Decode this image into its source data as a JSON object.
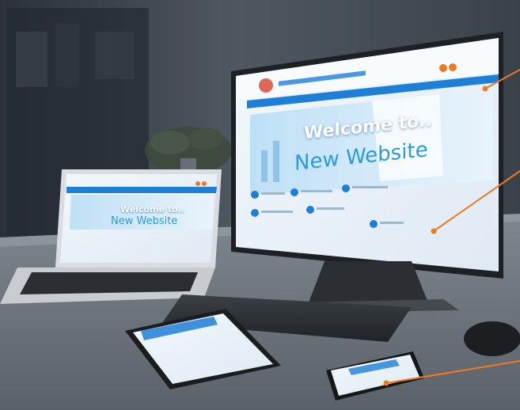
{
  "scene": {
    "description_kind": "responsive website mockup photo",
    "colors": {
      "wall": "#4a525a",
      "desk": "#8d949a",
      "accent_orange": "#f07a22",
      "site_blue": "#1e7fd6",
      "site_light": "#e6f2fb"
    }
  },
  "site": {
    "welcome_line1": "Welcome to..",
    "welcome_line2": "New Website"
  },
  "callouts": [
    {
      "name": "desktop-callout"
    },
    {
      "name": "banner-callout"
    },
    {
      "name": "phone-callout"
    }
  ]
}
